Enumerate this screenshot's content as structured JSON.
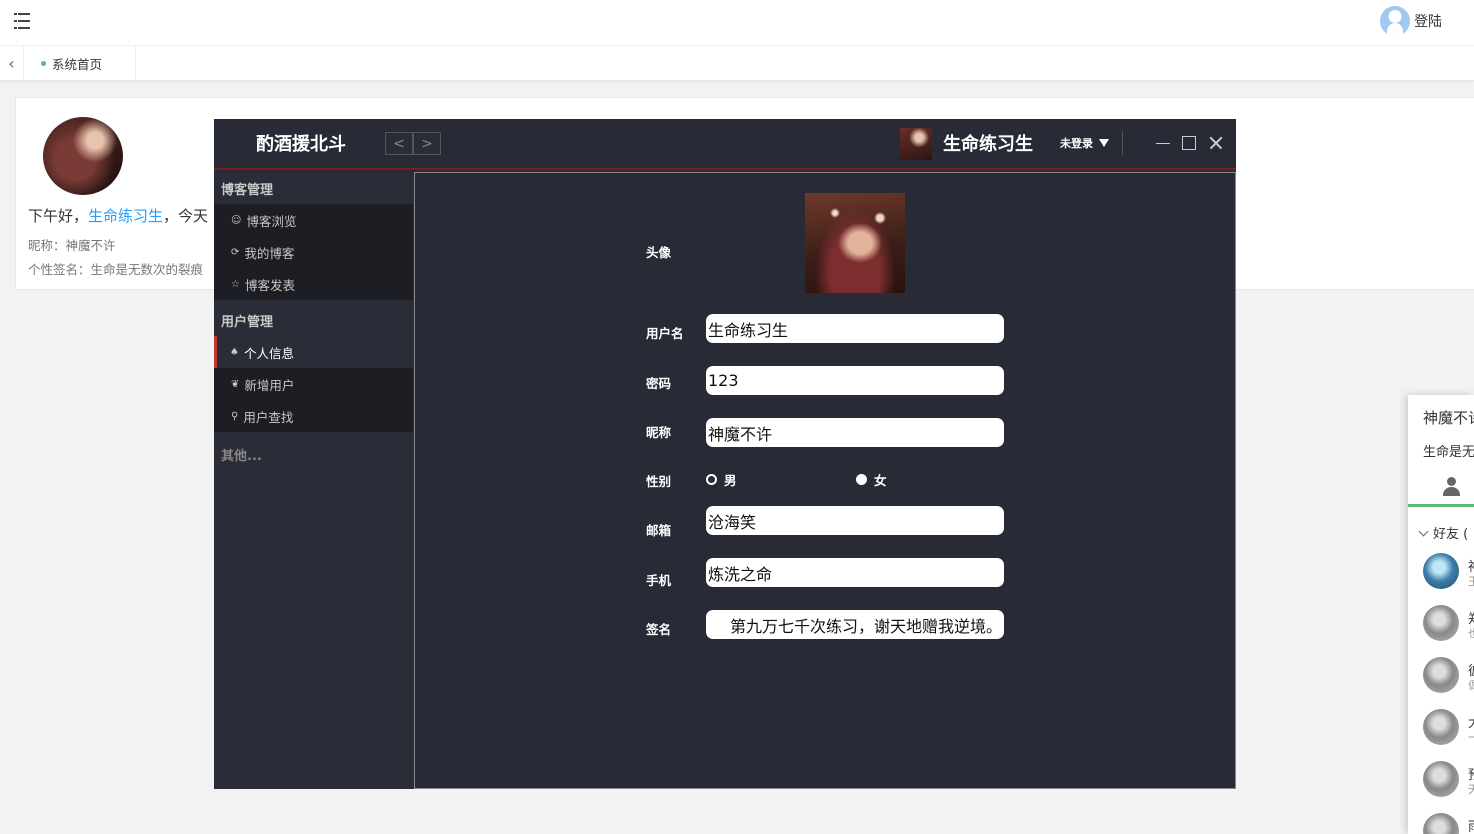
{
  "header": {
    "login_label": "登陆"
  },
  "tabs": {
    "home": "系统首页"
  },
  "welcome": {
    "greet_prefix": "下午好，",
    "greet_name": "生命练习生",
    "greet_suffix": "，今天",
    "nickname_line": "昵称：神魔不许",
    "signature_line": "个性签名：生命是无数次的裂痕"
  },
  "chat": {
    "name": "神魔不许",
    "sign": "生命是无数次的裂痕",
    "friends_header": "好友 (",
    "friends": [
      {
        "name": "神",
        "desc": "王"
      },
      {
        "name": "郑",
        "desc": "也"
      },
      {
        "name": "彼",
        "desc": "偶"
      },
      {
        "name": "大",
        "desc": "一"
      },
      {
        "name": "预",
        "desc": "天"
      },
      {
        "name": "雨",
        "desc": ""
      }
    ]
  },
  "window": {
    "app_title": "酌酒援北斗",
    "nav_prev": "<",
    "nav_next": ">",
    "user": "生命练习生",
    "status": "未登录"
  },
  "sidebar": {
    "blog_group": "博客管理",
    "blog_items": [
      {
        "icon": "☺",
        "label": "博客浏览"
      },
      {
        "icon": "⟳",
        "label": "我的博客"
      },
      {
        "icon": "☆",
        "label": "博客发表"
      }
    ],
    "user_group": "用户管理",
    "user_items": [
      {
        "icon": "♠",
        "label": "个人信息"
      },
      {
        "icon": "❦",
        "label": "新增用户"
      },
      {
        "icon": "⚲",
        "label": "用户查找"
      }
    ],
    "other": "其他..."
  },
  "form": {
    "avatar_label": "头像",
    "username_label": "用户名",
    "username": "生命练习生",
    "password_label": "密码",
    "password": "123",
    "nickname_label": "昵称",
    "nickname": "神魔不许",
    "gender_label": "性别",
    "gender_male": "男",
    "gender_female": "女",
    "gender_selected": "女",
    "email_label": "邮箱",
    "email": "沧海笑",
    "phone_label": "手机",
    "phone": "炼洗之命",
    "sign_label": "签名",
    "sign": "第九万七千次练习，谢天地赠我逆境。"
  }
}
